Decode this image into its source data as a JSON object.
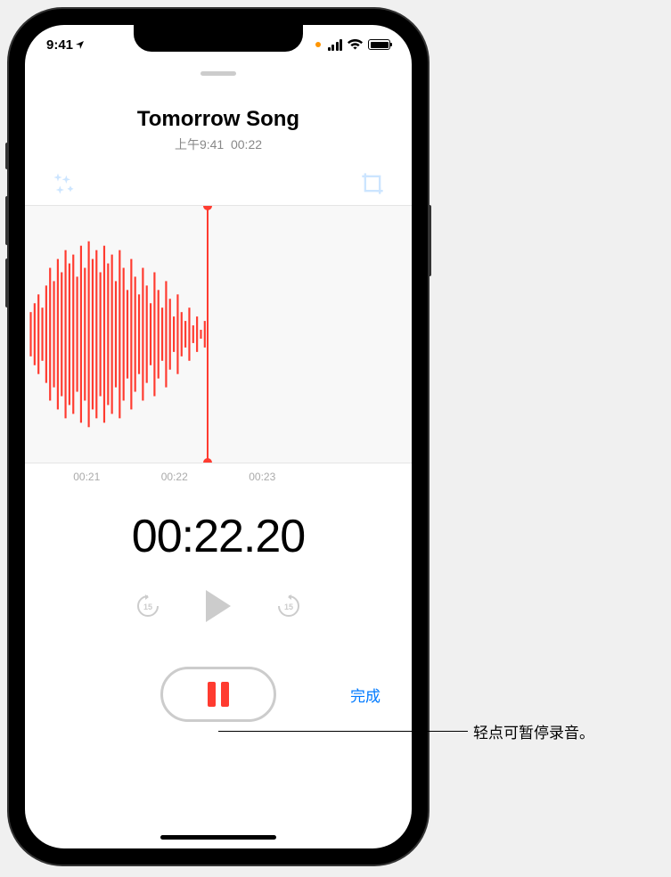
{
  "status": {
    "time": "9:41"
  },
  "recording": {
    "title": "Tomorrow Song",
    "time_prefix": "上午",
    "time": "9:41",
    "duration": "00:22"
  },
  "ruler": {
    "t1": "00:21",
    "t2": "00:22",
    "t3": "00:23"
  },
  "timer": "00:22.20",
  "done_label": "完成",
  "callout": "轻点可暂停录音。"
}
